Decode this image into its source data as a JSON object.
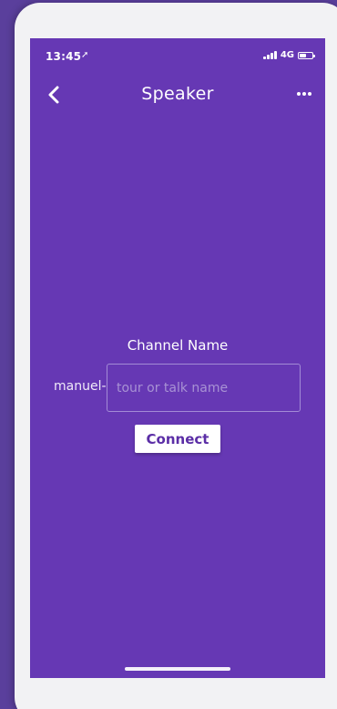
{
  "status_bar": {
    "time": "13:45",
    "location_icon": "location-arrow-icon",
    "network": "4G",
    "battery_level": 0.55
  },
  "nav": {
    "title": "Speaker",
    "back_icon": "chevron-left-icon",
    "more_icon": "more-horizontal-icon"
  },
  "form": {
    "label": "Channel Name",
    "prefix": "manuel-",
    "input_value": "",
    "input_placeholder": "tour or talk name",
    "connect_label": "Connect"
  },
  "colors": {
    "screen_bg": "#6638b4",
    "outer_bg": "#5a3f9c",
    "button_text": "#5b2ea6"
  }
}
